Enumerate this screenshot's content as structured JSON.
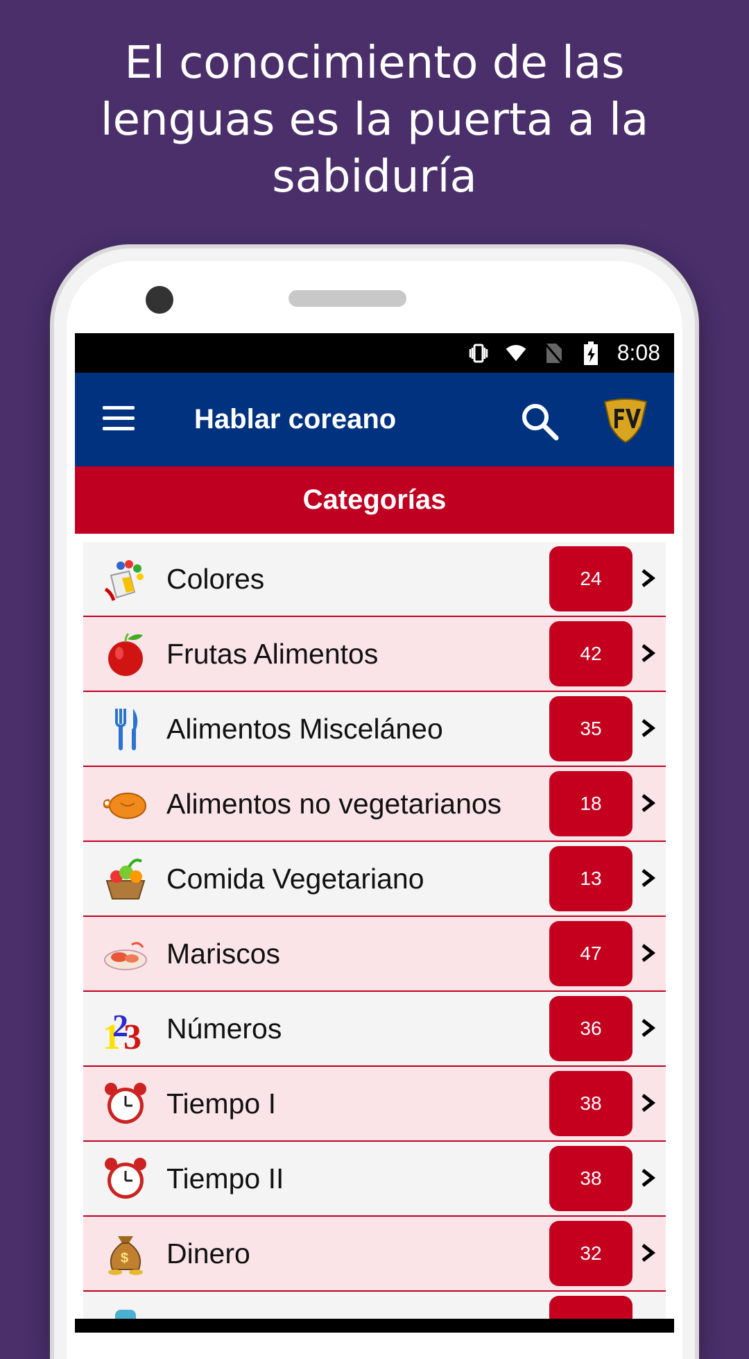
{
  "headline": "El conocimiento de las lenguas es la puerta a la sabiduría",
  "status_bar": {
    "time": "8:08",
    "icons": [
      "vibrate-icon",
      "wifi-icon",
      "no-sim-icon",
      "battery-charging-icon"
    ]
  },
  "app_bar": {
    "title": "Hablar coreano",
    "menu_icon": "hamburger-menu-icon",
    "search_icon": "search-icon",
    "logo": "FV"
  },
  "section": {
    "title": "Categorías"
  },
  "colors": {
    "purple_bg": "#4a2f6b",
    "app_bar": "#003280",
    "accent_red": "#c00020"
  },
  "categories": [
    {
      "label": "Colores",
      "count": "24",
      "icon": "paint-bucket-icon"
    },
    {
      "label": "Frutas Alimentos",
      "count": "42",
      "icon": "apple-icon"
    },
    {
      "label": "Alimentos Misceláneo",
      "count": "35",
      "icon": "fork-knife-icon"
    },
    {
      "label": "Alimentos no vegetarianos",
      "count": "18",
      "icon": "roast-chicken-icon"
    },
    {
      "label": "Comida Vegetariano",
      "count": "13",
      "icon": "vegetable-basket-icon"
    },
    {
      "label": "Mariscos",
      "count": "47",
      "icon": "seafood-platter-icon"
    },
    {
      "label": "Números",
      "count": "36",
      "icon": "numbers-123-icon"
    },
    {
      "label": "Tiempo I",
      "count": "38",
      "icon": "alarm-clock-icon"
    },
    {
      "label": "Tiempo II",
      "count": "38",
      "icon": "alarm-clock-icon"
    },
    {
      "label": "Dinero",
      "count": "32",
      "icon": "money-bag-icon"
    }
  ]
}
